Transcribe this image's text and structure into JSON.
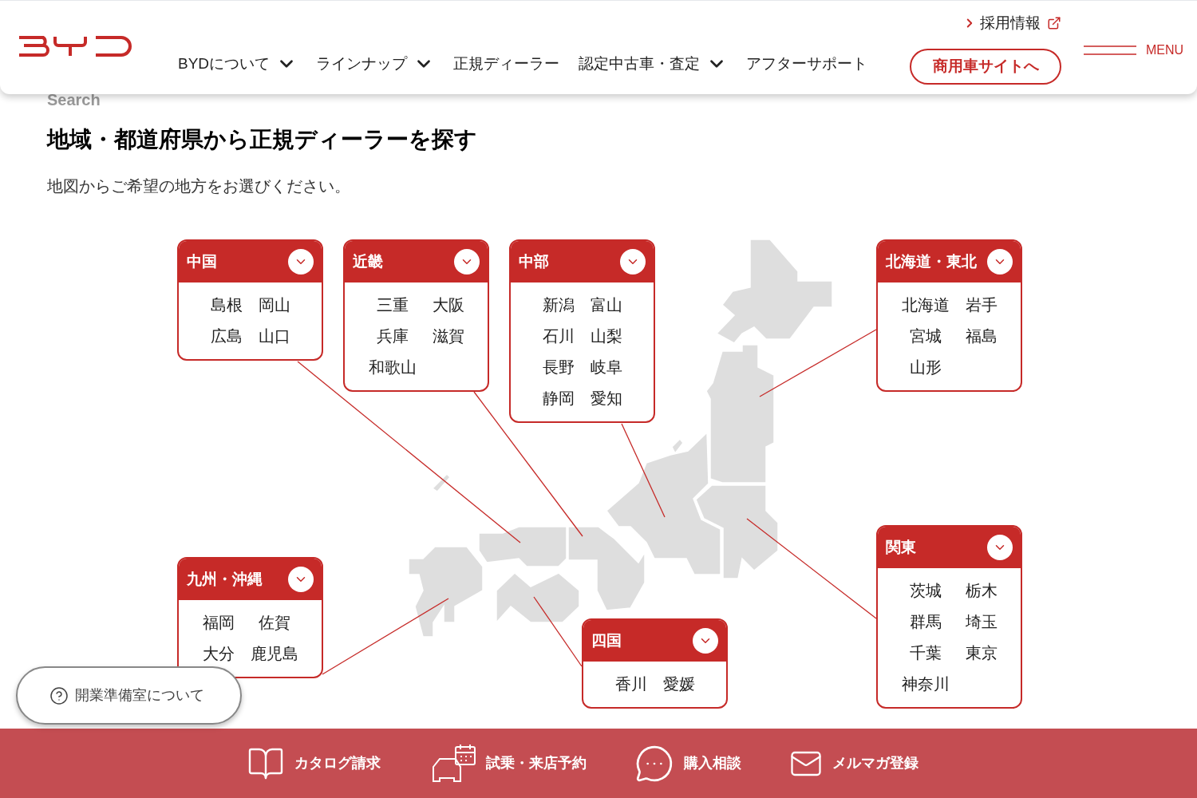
{
  "header": {
    "recruit_link": "採用情報",
    "nav": [
      {
        "label": "BYDについて",
        "has_dropdown": true
      },
      {
        "label": "ラインナップ",
        "has_dropdown": true
      },
      {
        "label": "正規ディーラー",
        "has_dropdown": false
      },
      {
        "label": "認定中古車・査定",
        "has_dropdown": true
      },
      {
        "label": "アフターサポート",
        "has_dropdown": false
      }
    ],
    "commercial_button": "商用車サイトへ",
    "menu_label": "MENU"
  },
  "page": {
    "eyebrow": "Search",
    "title": "地域・都道府県から正規ディーラーを探す",
    "subtitle": "地図からご希望の地方をお選びください。"
  },
  "regions": [
    {
      "name": "中国",
      "prefectures": [
        "島根",
        "岡山",
        "広島",
        "山口"
      ]
    },
    {
      "name": "近畿",
      "prefectures": [
        "三重",
        "大阪",
        "兵庫",
        "滋賀",
        "和歌山"
      ]
    },
    {
      "name": "中部",
      "prefectures": [
        "新潟",
        "富山",
        "石川",
        "山梨",
        "長野",
        "岐阜",
        "静岡",
        "愛知"
      ]
    },
    {
      "name": "北海道・東北",
      "prefectures": [
        "北海道",
        "岩手",
        "宮城",
        "福島",
        "山形"
      ]
    },
    {
      "name": "九州・沖縄",
      "prefectures": [
        "福岡",
        "佐賀",
        "大分",
        "鹿児島"
      ]
    },
    {
      "name": "四国",
      "prefectures": [
        "香川",
        "愛媛"
      ]
    },
    {
      "name": "関東",
      "prefectures": [
        "茨城",
        "栃木",
        "群馬",
        "埼玉",
        "千葉",
        "東京",
        "神奈川"
      ]
    }
  ],
  "help_button": "開業準備室について",
  "footer_actions": [
    {
      "kind": "catalog",
      "label": "カタログ請求"
    },
    {
      "kind": "test_drive",
      "label": "試乗・来店予約"
    },
    {
      "kind": "chat",
      "label": "購入相談"
    },
    {
      "kind": "mail",
      "label": "メルマガ登録"
    }
  ]
}
